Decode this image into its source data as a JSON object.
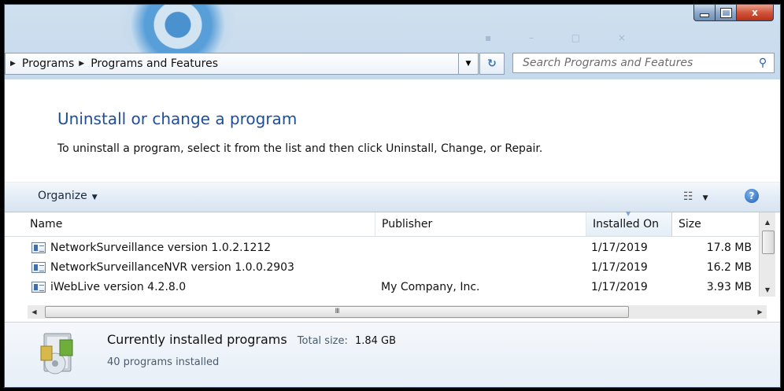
{
  "window": {
    "controls": {
      "minimize": "–",
      "maximize": "□",
      "close": "x"
    }
  },
  "address": {
    "crumbs": [
      "Programs",
      "Programs and Features"
    ]
  },
  "search": {
    "placeholder": "Search Programs and Features"
  },
  "task": {
    "title": "Uninstall or change a program",
    "description": "To uninstall a program, select it from the list and then click Uninstall, Change, or Repair."
  },
  "toolbar": {
    "organize_label": "Organize"
  },
  "list": {
    "columns": [
      "Name",
      "Publisher",
      "Installed On",
      "Size"
    ],
    "sorted_column": "Installed On",
    "rows": [
      {
        "name": "NetworkSurveillance version 1.0.2.1212",
        "publisher": "",
        "installed_on": "1/17/2019",
        "size": "17.8 MB"
      },
      {
        "name": "NetworkSurveillanceNVR version 1.0.0.2903",
        "publisher": "",
        "installed_on": "1/17/2019",
        "size": "16.2 MB"
      },
      {
        "name": "iWebLive version 4.2.8.0",
        "publisher": "My Company, Inc.",
        "installed_on": "1/17/2019",
        "size": "3.93 MB"
      }
    ]
  },
  "details": {
    "summary_title": "Currently installed programs",
    "total_size_label": "Total size:",
    "total_size_value": "1.84 GB",
    "count_text": "40 programs installed"
  },
  "hscroll": {
    "thumb_grip": "III"
  }
}
